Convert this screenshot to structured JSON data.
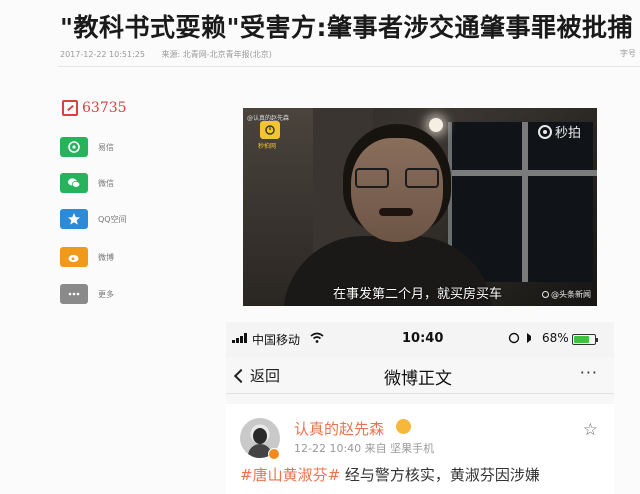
{
  "article": {
    "headline": "\"教科书式耍赖\"受害方:肇事者涉交通肇事罪被批捕",
    "timestamp": "2017-12-22 10:51:25",
    "source": "来源: 北青网-北京青年报(北京)",
    "right_link": "字号"
  },
  "social": {
    "comment_count": "63735",
    "share_items": [
      {
        "label": "易信",
        "icon": "yixin-icon",
        "color": "#27b35b"
      },
      {
        "label": "微信",
        "icon": "wechat-icon",
        "color": "#27b35b"
      },
      {
        "label": "QQ空间",
        "icon": "qzone-icon",
        "color": "#2d8ad6"
      },
      {
        "label": "微博",
        "icon": "weibo-icon",
        "color": "#f09a1b"
      },
      {
        "label": "更多",
        "icon": "more-icon",
        "color": "#8a8a8a"
      }
    ]
  },
  "video": {
    "top_label": "@认真的赵先森",
    "logo_caption": "秒拍网",
    "miaopai_brand": "秒拍",
    "subtitle": "在事发第二个月，就买房买车",
    "watermark": "@头条新闻"
  },
  "phone": {
    "carrier": "中国移动",
    "time": "10:40",
    "battery": "68%",
    "back_label": "返回",
    "nav_title": "微博正文",
    "more": "···",
    "username": "认真的赵先森",
    "post_meta": "12-22 10:40  来自 坚果手机",
    "post_tag": "#唐山黄淑芬#",
    "post_text": " 经与警方核实，黄淑芬因涉嫌"
  }
}
